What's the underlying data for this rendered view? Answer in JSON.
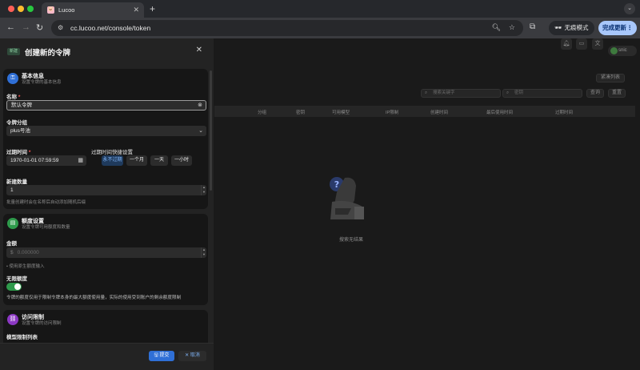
{
  "browser": {
    "tab_title": "Lucoo",
    "url": "cc.lucoo.net/console/token",
    "incognito_label": "无痕模式",
    "update_label": "完成更新"
  },
  "page": {
    "user_label": "snic",
    "compact_label": "紧凑列表",
    "filter_key_placeholder": "搜索关键字",
    "filter_token_placeholder": "密钥",
    "query_label": "查询",
    "reset_label": "重置",
    "columns": [
      "分组",
      "密钥",
      "可用模型",
      "IP限制",
      "创建时间",
      "最后使用时间",
      "过期时间"
    ],
    "empty_text": "搜索无结果"
  },
  "sheet": {
    "tag": "新建",
    "title": "创建新的令牌",
    "basic": {
      "title": "基本信息",
      "subtitle": "设置令牌的基本信息",
      "name_label": "名称",
      "name_value": "默认令牌",
      "group_label": "令牌分组",
      "group_value": "plus号池",
      "expire_label": "过期时间",
      "expire_value": "1970-01-01 07:59:59",
      "quick_label": "过期时间快捷设置",
      "quick_options": [
        "永不过期",
        "一个月",
        "一天",
        "一小时"
      ],
      "count_label": "新建数量",
      "count_value": "1",
      "count_help": "批量创建时会在名称后自动添加随机后缀"
    },
    "quota": {
      "title": "额度设置",
      "subtitle": "设置令牌可用额度和数量",
      "amount_label": "金额",
      "currency": "$",
      "amount_placeholder": "0.000000",
      "amount_help": "• 使用原生额度输入",
      "unlimited_label": "无限额度",
      "unlimited_on": true,
      "note": "令牌的额度仅用于限制令牌本身的最大额度使用量，实际的使用受到账户的剩余额度限制"
    },
    "access": {
      "title": "访问限制",
      "subtitle": "设置令牌的访问限制",
      "model_limit_label": "模型限制列表"
    },
    "submit_label": "提交",
    "cancel_label": "取消"
  },
  "colors": {
    "accent_blue": "#2f6fd6",
    "success_green": "#2e9a4b",
    "purple": "#8c38c4",
    "required_red": "#f55"
  }
}
